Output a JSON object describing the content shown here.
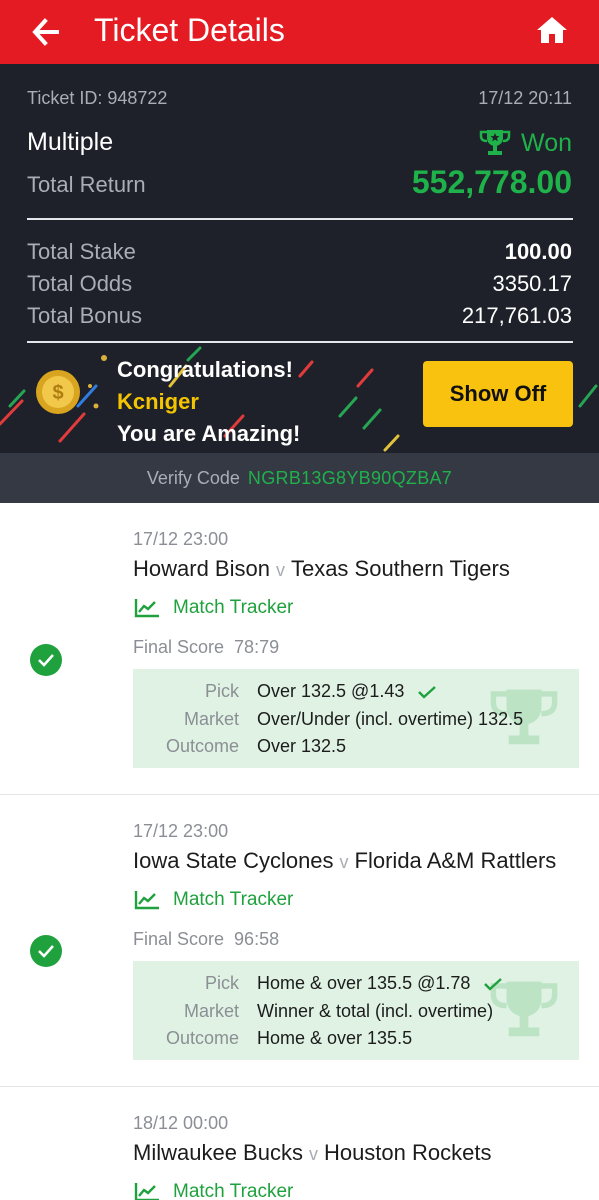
{
  "header": {
    "title": "Ticket Details",
    "back_icon": "arrow-left-icon",
    "home_icon": "home-icon"
  },
  "summary": {
    "ticket_id": "Ticket ID: 948722",
    "datetime": "17/12 20:11",
    "bet_type": "Multiple",
    "status": "Won",
    "total_return_label": "Total Return",
    "total_return": "552,778.00",
    "rows": [
      {
        "label": "Total Stake",
        "value": "100.00"
      },
      {
        "label": "Total Odds",
        "value": "3350.17"
      },
      {
        "label": "Total Bonus",
        "value": "217,761.03"
      }
    ]
  },
  "congrats": {
    "line1": "Congratulations!",
    "user": "Kcniger",
    "line3": "You are Amazing!",
    "button": "Show Off"
  },
  "verify": {
    "label": "Verify Code",
    "code": "NGRB13G8YB90QZBA7"
  },
  "matches": [
    {
      "date": "17/12 23:00",
      "home": "Howard Bison",
      "away": "Texas Southern Tigers",
      "vs": "v",
      "tracker": "Match Tracker",
      "final_label": "Final Score",
      "final_score": "78:79",
      "pick_label": "Pick",
      "pick": "Over 132.5 @1.43",
      "market_label": "Market",
      "market": "Over/Under (incl. overtime) 132.5",
      "outcome_label": "Outcome",
      "outcome": "Over 132.5"
    },
    {
      "date": "17/12 23:00",
      "home": "Iowa State Cyclones",
      "away": "Florida A&M Rattlers",
      "vs": "v",
      "tracker": "Match Tracker",
      "final_label": "Final Score",
      "final_score": "96:58",
      "pick_label": "Pick",
      "pick": "Home & over 135.5 @1.78",
      "market_label": "Market",
      "market": "Winner & total (incl. overtime)",
      "outcome_label": "Outcome",
      "outcome": "Home & over 135.5"
    },
    {
      "date": "18/12 00:00",
      "home": "Milwaukee Bucks",
      "away": "Houston Rockets",
      "vs": "v",
      "tracker": "Match Tracker"
    }
  ],
  "colors": {
    "brand_red": "#e41b23",
    "win_green": "#1fb14a",
    "dark_bg": "#1e2129",
    "gold": "#f8c20e"
  }
}
